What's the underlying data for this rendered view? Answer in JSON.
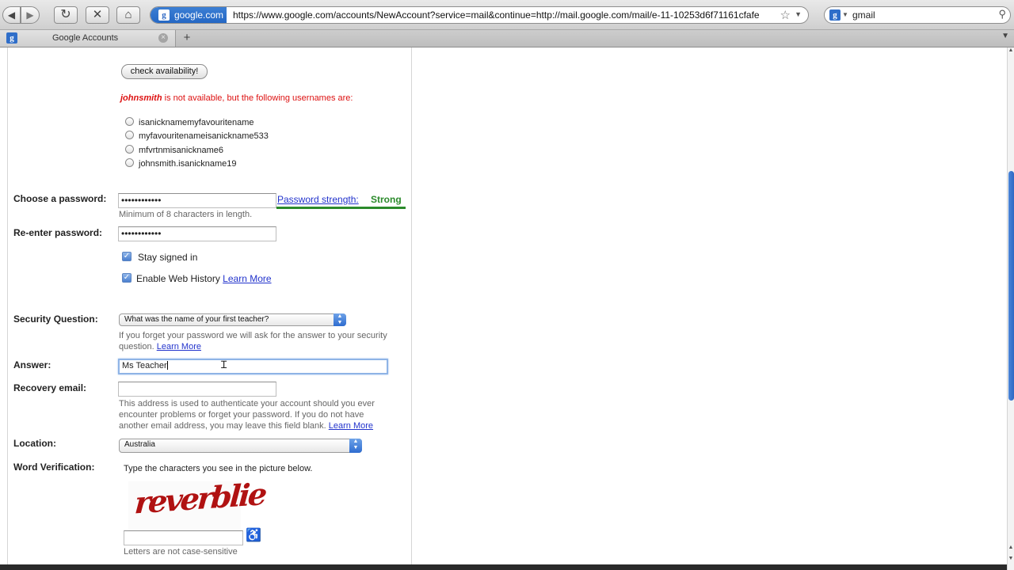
{
  "browser": {
    "site_identity": "google.com",
    "url": "https://www.google.com/accounts/NewAccount?service=mail&continue=http://mail.google.com/mail/e-11-10253d6f71161cfafe",
    "search_query": "gmail",
    "tab_title": "Google Accounts",
    "new_tab": "+",
    "nav_back": "◀",
    "nav_forward": "▶",
    "nav_reload": "↻",
    "nav_stop": "✕",
    "nav_home": "⌂"
  },
  "form": {
    "check_availability_label": "check availability!",
    "unavailable_username": "johnsmith",
    "unavailable_message_rest": " is not available, but the following usernames are:",
    "suggestions": [
      "isanicknamemyfavouritename",
      "myfavouritenameisanickname533",
      "mfvrtnmisanickname6",
      "johnsmith.isanickname19"
    ],
    "password_label": "Choose a password:",
    "password_value": "••••••••••••",
    "password_strength_link": "Password strength:",
    "password_strength_value": "Strong",
    "password_hint": "Minimum of 8 characters in length.",
    "reenter_label": "Re-enter password:",
    "reenter_value": "••••••••••••",
    "stay_signed_in_label": "Stay signed in",
    "stay_signed_in_checked": true,
    "web_history_label": "Enable Web History",
    "web_history_checked": true,
    "learn_more": "Learn More",
    "security_question_label": "Security Question:",
    "security_question_value": "What was the name of your first teacher?",
    "security_hint_line1": "If you forget your password we will ask for the answer to your security",
    "security_hint_line2": "question.",
    "answer_label": "Answer:",
    "answer_value": "Ms Teacher",
    "recovery_label": "Recovery email:",
    "recovery_value": "",
    "recovery_hint_line1": "This address is used to authenticate your account should you ever",
    "recovery_hint_line2": "encounter problems or forget your password. If you do not have",
    "recovery_hint_line3": "another email address, you may leave this field blank.",
    "location_label": "Location:",
    "location_value": "Australia",
    "word_verification_label": "Word Verification:",
    "word_verification_instructions": "Type the characters you see in the picture below.",
    "captcha_text": "reverblie",
    "captcha_input_value": "",
    "case_hint": "Letters are not case-sensitive"
  }
}
